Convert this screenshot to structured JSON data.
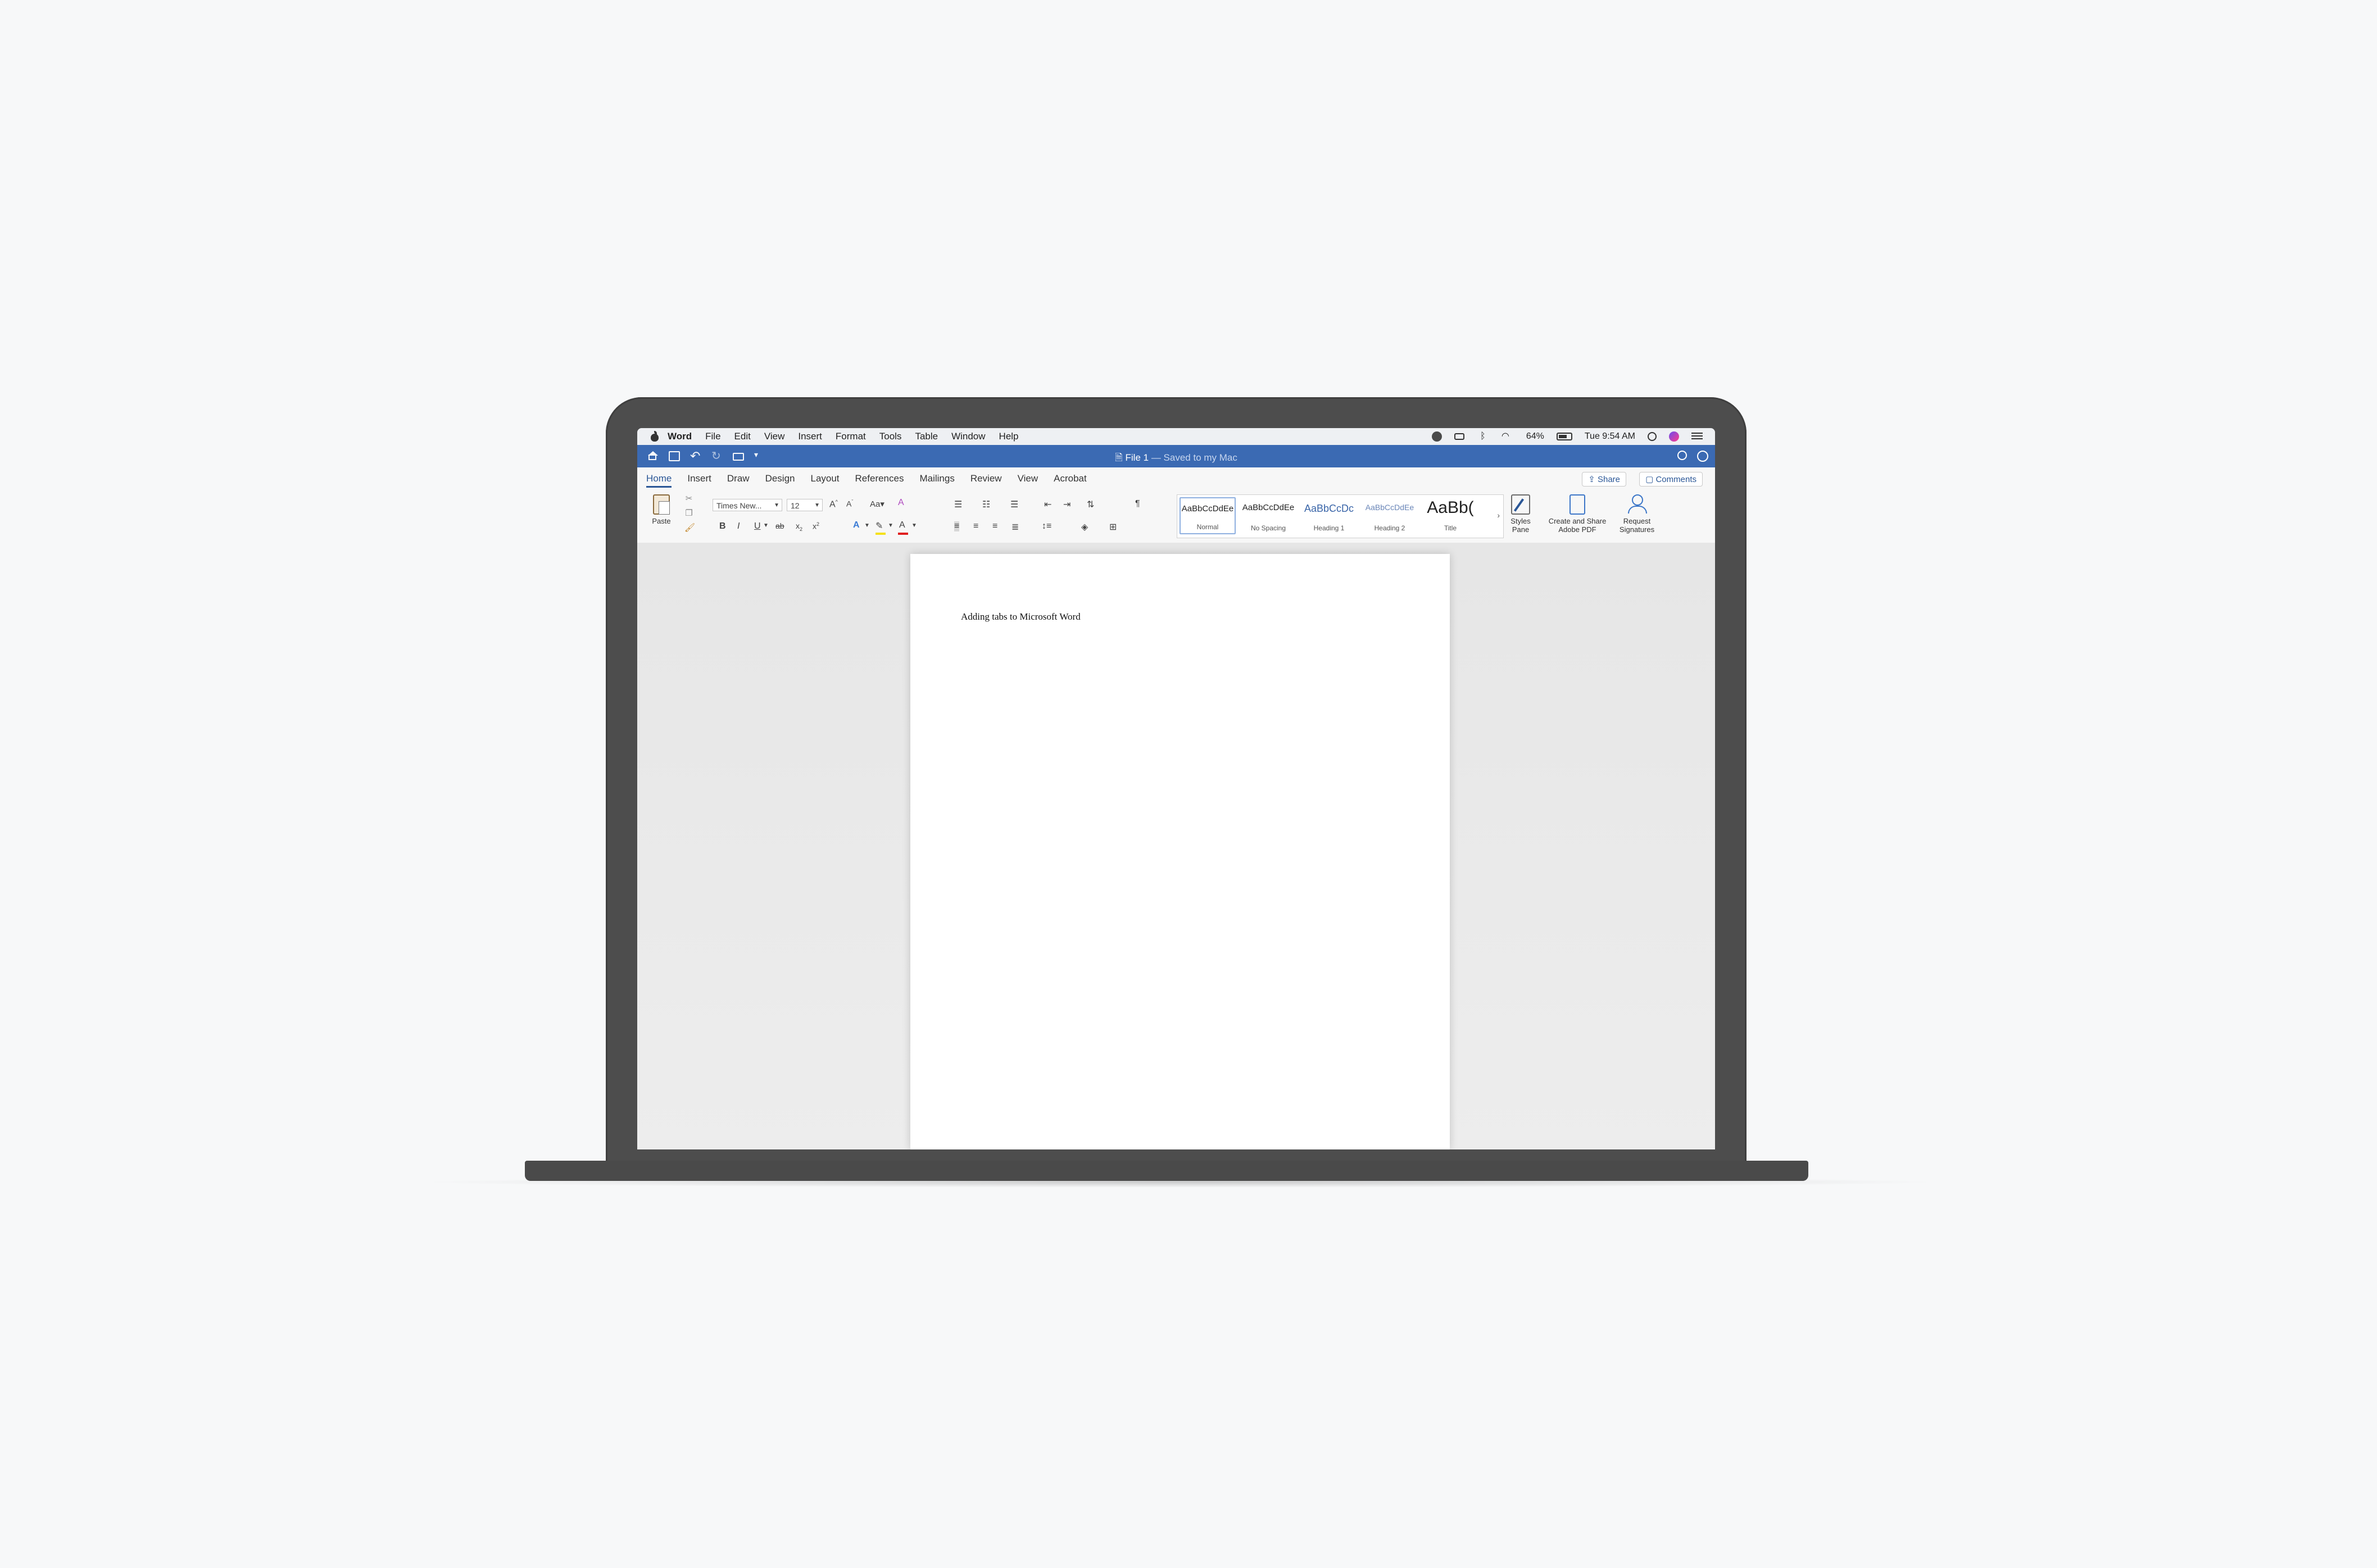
{
  "menubar": {
    "items": [
      "Word",
      "File",
      "Edit",
      "View",
      "Insert",
      "Format",
      "Tools",
      "Table",
      "Window",
      "Help"
    ],
    "battery": "64%",
    "clock": "Tue 9:54 AM"
  },
  "titlebar": {
    "doc_name": "File 1",
    "saved_status": "— Saved to my Mac"
  },
  "ribbon_tabs": [
    "Home",
    "Insert",
    "Draw",
    "Design",
    "Layout",
    "References",
    "Mailings",
    "Review",
    "View",
    "Acrobat"
  ],
  "share_label": "Share",
  "comments_label": "Comments",
  "ribbon": {
    "paste_label": "Paste",
    "font_name": "Times New...",
    "font_size": "12",
    "bold": "B",
    "italic": "I",
    "underline": "U",
    "strike": "ab",
    "styles": [
      {
        "sample": "AaBbCcDdEe",
        "name": "Normal"
      },
      {
        "sample": "AaBbCcDdEe",
        "name": "No Spacing"
      },
      {
        "sample": "AaBbCcDc",
        "name": "Heading 1"
      },
      {
        "sample": "AaBbCcDdEe",
        "name": "Heading 2"
      },
      {
        "sample": "AaBb(",
        "name": "Title"
      }
    ],
    "styles_pane_label": "Styles Pane",
    "create_pdf_label": "Create and Share Adobe PDF",
    "request_sig_label": "Request Signatures"
  },
  "document": {
    "text": "Adding tabs to Microsoft Word"
  },
  "colors": {
    "titlebar": "#3b6ab3",
    "accent": "#2b5797",
    "highlight": "#f5e11b",
    "font_color": "#e02020"
  }
}
